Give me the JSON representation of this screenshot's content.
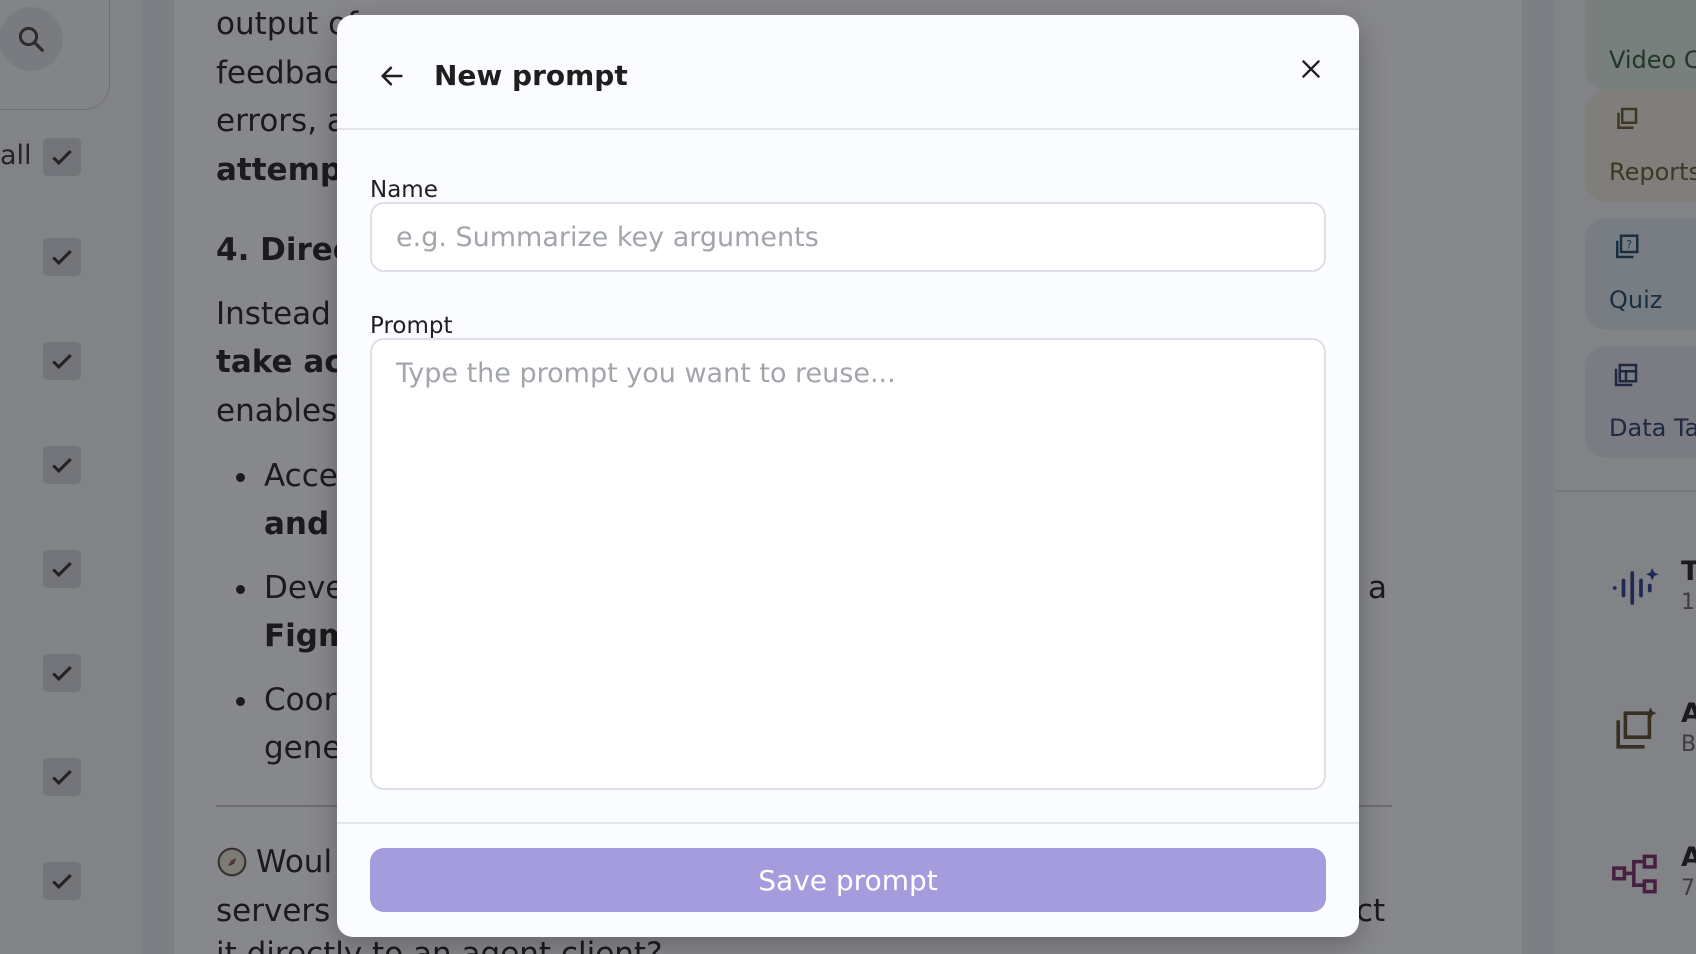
{
  "modal": {
    "title": "New prompt",
    "name_label": "Name",
    "name_placeholder": "e.g. Summarize key arguments",
    "prompt_label": "Prompt",
    "prompt_placeholder": "Type the prompt you want to reuse...",
    "save_label": "Save prompt",
    "icons": {
      "back": "arrow-left-icon",
      "close": "close-icon"
    }
  },
  "background": {
    "left": {
      "all_label": "all",
      "checkbox_count": 8
    },
    "document": {
      "lines": [
        "output of",
        "feedbac",
        "errors, a",
        "attempt",
        "4. Direc",
        "Instead o",
        "take act",
        "enables",
        "Acce",
        "and I",
        "Deve",
        "Figm",
        "Coor",
        "gene",
        "Woul",
        "servers f",
        "a",
        "ct",
        "it directly to an agent client?"
      ]
    },
    "right_panel": {
      "cards": [
        "Video C",
        "Reports",
        "Quiz",
        "Data Ta"
      ],
      "items": [
        {
          "title": "T",
          "subtitle": "1"
        },
        {
          "title": "A",
          "subtitle": "B"
        },
        {
          "title": "A",
          "subtitle": "7"
        }
      ]
    }
  },
  "colors": {
    "accent_disabled": "#a49cdd",
    "overlay": "rgba(20,20,24,0.5)",
    "card_video": "#dcebe0",
    "card_reports": "#ebe8dc",
    "card_quiz": "#dbe7ee",
    "card_data": "#e2e5ef"
  }
}
